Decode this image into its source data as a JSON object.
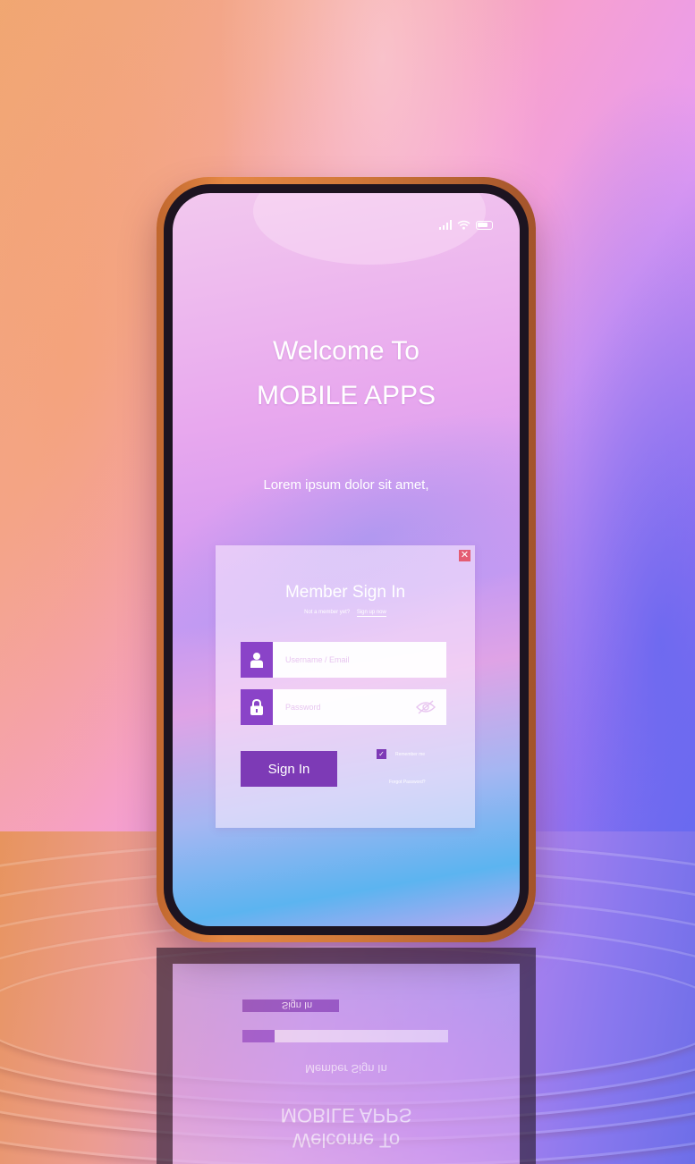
{
  "status_bar": {
    "signal_icon": "signal-bars-icon",
    "wifi_icon": "wifi-icon",
    "battery_icon": "battery-icon"
  },
  "hero": {
    "welcome_line1": "Welcome To",
    "welcome_line2": "MOBILE APPS",
    "tagline": "Lorem ipsum dolor sit amet,"
  },
  "sign_in_card": {
    "title": "Member Sign In",
    "not_member_text": "Not a member yet?",
    "signup_link": "Sign up now",
    "close_icon": "close-icon",
    "username": {
      "value": "",
      "placeholder": "Username / Email",
      "icon": "user-icon"
    },
    "password": {
      "value": "",
      "placeholder": "Password",
      "icon": "lock-icon",
      "toggle_icon": "eye-slash-icon"
    },
    "sign_in_label": "Sign In",
    "remember_me_label": "Remember me",
    "remember_me_checked": true,
    "forgot_password_label": "Forgot Password?"
  },
  "reflection": {
    "line1": "Welcome To",
    "line2": "MOBILE APPS",
    "card_title": "Member Sign In",
    "sign_in_label": "Sign In"
  },
  "colors": {
    "accent_purple": "#7d3ab6",
    "icon_purple": "#8a43c8",
    "close_red": "#e45c72",
    "phone_frame": "#d37a3a"
  }
}
